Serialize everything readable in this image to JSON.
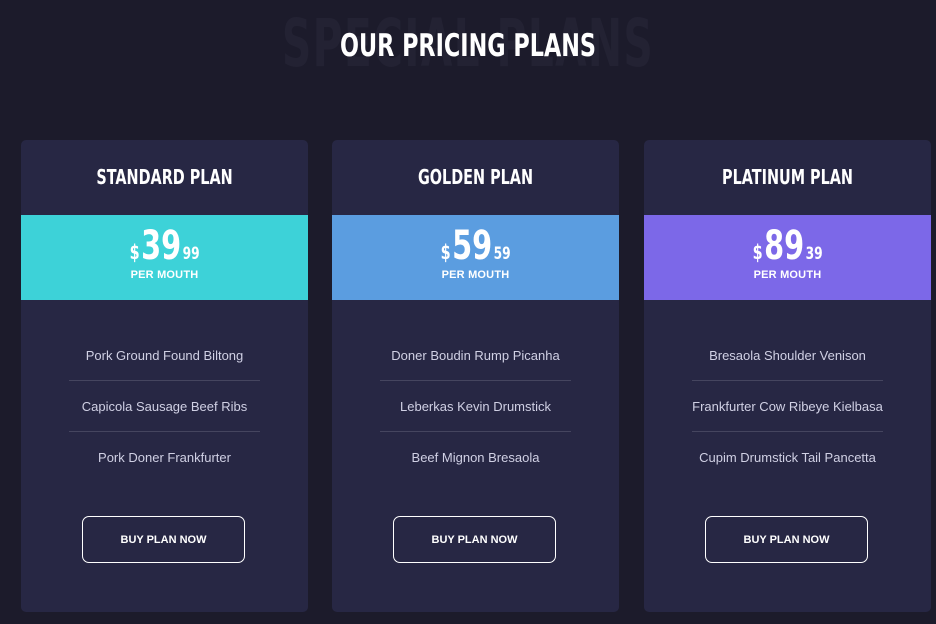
{
  "section": {
    "background_title": "SPECIAL PLANS",
    "title": "OUR PRICING PLANS"
  },
  "plans": [
    {
      "name": "STANDARD PLAN",
      "currency": "$",
      "amount": "39",
      "cents": "99",
      "period": "PER MOUTH",
      "color": "#3dd2d8",
      "features": [
        "Pork Ground Found Biltong",
        "Capicola Sausage Beef Ribs",
        "Pork Doner Frankfurter"
      ],
      "button": "BUY PLAN NOW"
    },
    {
      "name": "GOLDEN PLAN",
      "currency": "$",
      "amount": "59",
      "cents": "59",
      "period": "PER MOUTH",
      "color": "#5b9de0",
      "features": [
        "Doner Boudin Rump Picanha",
        "Leberkas Kevin Drumstick",
        "Beef Mignon Bresaola"
      ],
      "button": "BUY PLAN NOW"
    },
    {
      "name": "PLATINUM PLAN",
      "currency": "$",
      "amount": "89",
      "cents": "39",
      "period": "PER MOUTH",
      "color": "#7c68e8",
      "features": [
        "Bresaola Shoulder Venison",
        "Frankfurter Cow Ribeye Kielbasa",
        "Cupim Drumstick Tail Pancetta"
      ],
      "button": "BUY PLAN NOW"
    }
  ],
  "colors": {
    "page_background": "#1c1b2b",
    "card_background": "#272744"
  }
}
